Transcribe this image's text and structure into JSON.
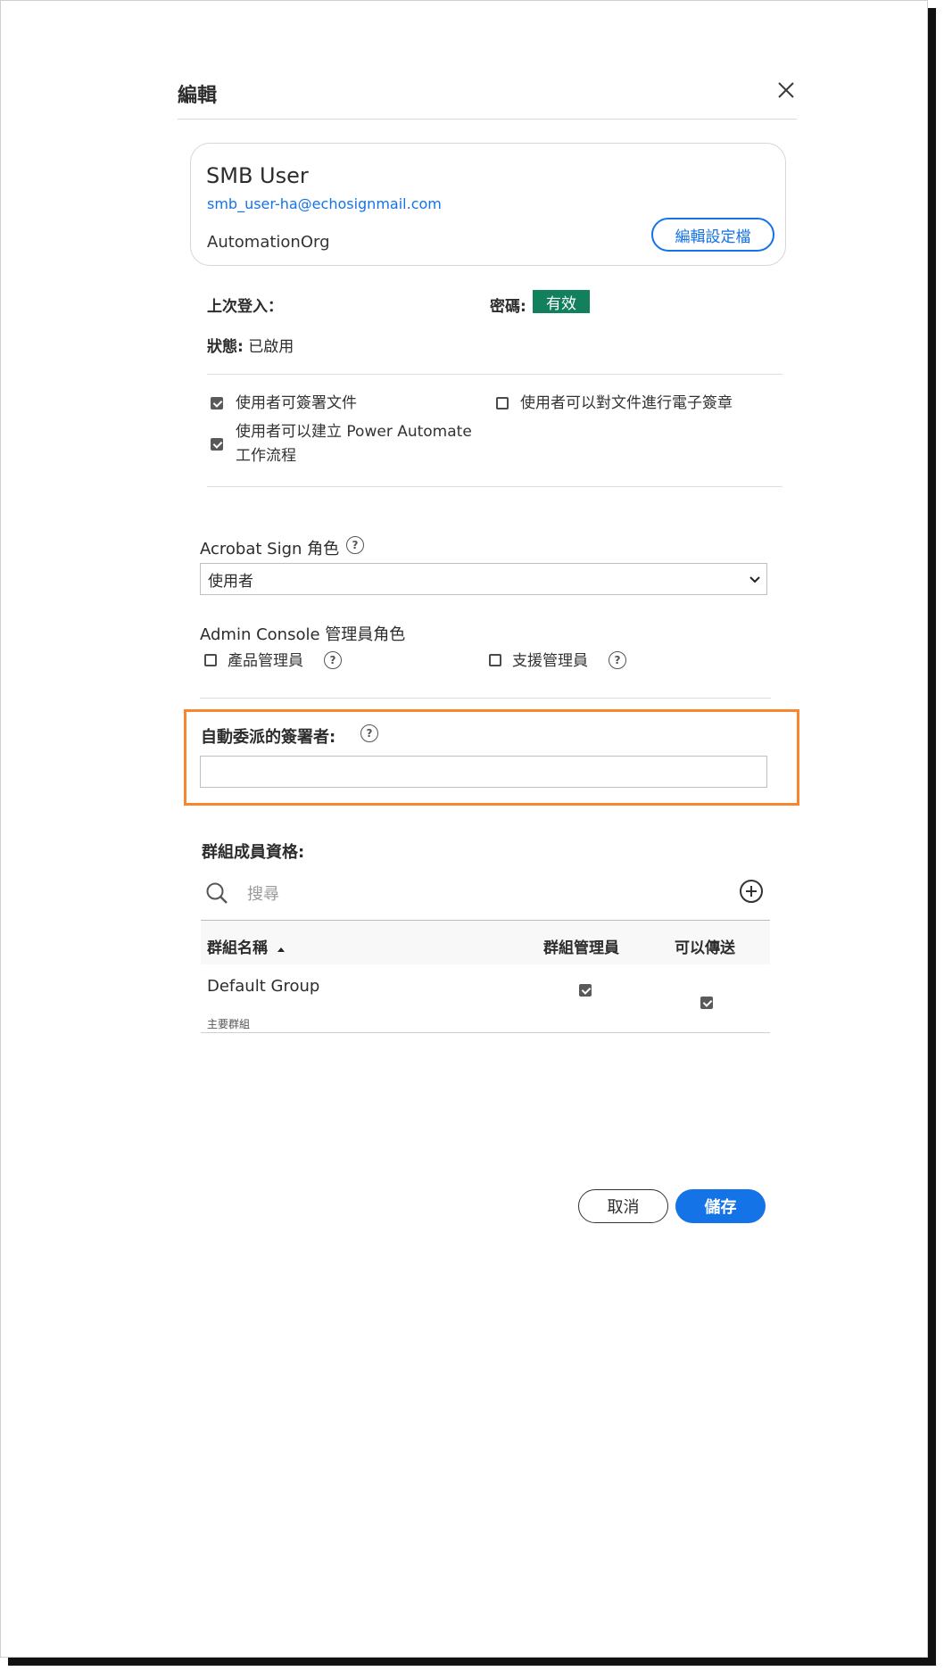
{
  "dialog": {
    "title": "編輯"
  },
  "user": {
    "name": "SMB User",
    "email": "smb_user-ha@echosignmail.com",
    "org": "AutomationOrg",
    "edit_profile_label": "編輯設定檔"
  },
  "info": {
    "last_login_label": "上次登入：",
    "password_label": "密碼:",
    "password_status": "有效",
    "status_label": "狀態:",
    "status_value": "已啟用"
  },
  "permissions": {
    "can_sign": {
      "label": "使用者可簽署文件",
      "checked": true
    },
    "can_create_flow": {
      "label_line1": "使用者可以建立 Power Automate",
      "label_line2": "工作流程",
      "checked": true
    },
    "can_esign": {
      "label": "使用者可以對文件進行電子簽章",
      "checked": false
    }
  },
  "sign_role": {
    "label": "Acrobat Sign 角色",
    "selected": "使用者"
  },
  "admin_console": {
    "label": "Admin Console 管理員角色",
    "product_admin": {
      "label": "產品管理員",
      "checked": false
    },
    "support_admin": {
      "label": "支援管理員",
      "checked": false
    }
  },
  "auto_delegate": {
    "label": "自動委派的簽署者:",
    "value": ""
  },
  "groups": {
    "label": "群組成員資格:",
    "search_placeholder": "搜尋",
    "columns": {
      "name": "群組名稱",
      "admin": "群組管理員",
      "can_send": "可以傳送"
    },
    "rows": [
      {
        "name": "Default Group",
        "sub": "主要群組",
        "admin": true,
        "can_send": true
      }
    ]
  },
  "footer": {
    "cancel_label": "取消",
    "save_label": "儲存"
  },
  "colors": {
    "accent": "#1473e6",
    "valid_badge": "#12805c",
    "highlight": "#f7862f"
  }
}
